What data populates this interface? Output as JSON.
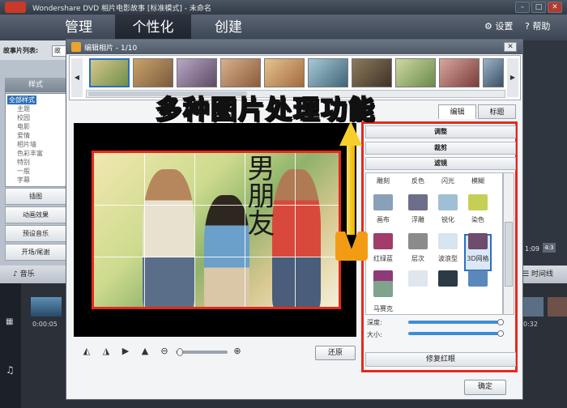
{
  "app": {
    "title": "Wondershare DVD 相片电影故事 [标准模式] - 未命名",
    "minimize": "–",
    "maximize": "□",
    "close": "✕"
  },
  "menu": {
    "tabs": [
      "管理",
      "个性化",
      "创建"
    ],
    "settings": "设置",
    "help": "帮助"
  },
  "left": {
    "story_label": "故事片列表:",
    "story_value": "故",
    "style_header": "样式",
    "tree": [
      "全部样式",
      "主题",
      "校园",
      "电影",
      "爱情",
      "相片墙",
      "色彩丰富",
      "特别",
      "一般",
      "字幕"
    ],
    "buttons": [
      "插图",
      "动画效果",
      "预设音乐",
      "开场/尾谢"
    ]
  },
  "timeline": {
    "music_tab": "音乐",
    "timeline_tab": "时间线",
    "clip_time": "0:00:05",
    "right_time": "0:32",
    "strip_time": "1:09",
    "strip_ratio": "4:3"
  },
  "dialog": {
    "title": "编辑相片 - 1/10",
    "close": "✕",
    "tabs": {
      "edit": "编辑",
      "caption": "标题"
    },
    "sections": {
      "adjust": "调整",
      "crop": "裁剪",
      "filter": "滤镜"
    },
    "filters": [
      {
        "label": "雕刻",
        "color": "#8aa0b8"
      },
      {
        "label": "反色",
        "color": "#6d6f8a"
      },
      {
        "label": "闪光",
        "color": "#9fbfd6"
      },
      {
        "label": "模糊",
        "color": "#c6cf55"
      },
      {
        "label": "画布",
        "color": "#a23c6a"
      },
      {
        "label": "浮雕",
        "color": "#8b8b8b"
      },
      {
        "label": "锐化",
        "color": "#d8e4ee"
      },
      {
        "label": "染色",
        "color": "#6d4c6e"
      },
      {
        "label": "红绿蓝",
        "color": "#8e3a78"
      },
      {
        "label": "层次",
        "color": "#e0e6ee"
      },
      {
        "label": "波浪型",
        "color": "#2c3946"
      },
      {
        "label": "3D网格",
        "color": "#5a88bd"
      },
      {
        "label": "马赛克",
        "color": "#7fa38d"
      }
    ],
    "sliders": {
      "depth_label": "深度:",
      "size_label": "大小:",
      "depth": 1.0,
      "size": 1.0
    },
    "redeye": "修复红眼",
    "restore": "还原",
    "confirm": "确定",
    "calligraphy": "男朋友"
  },
  "overlay": {
    "text": "多种图片处理功能"
  },
  "colors": {
    "accent_red": "#e8281c",
    "arrow_yellow": "#f6cf2c",
    "selection_blue": "#2b6fc3"
  }
}
